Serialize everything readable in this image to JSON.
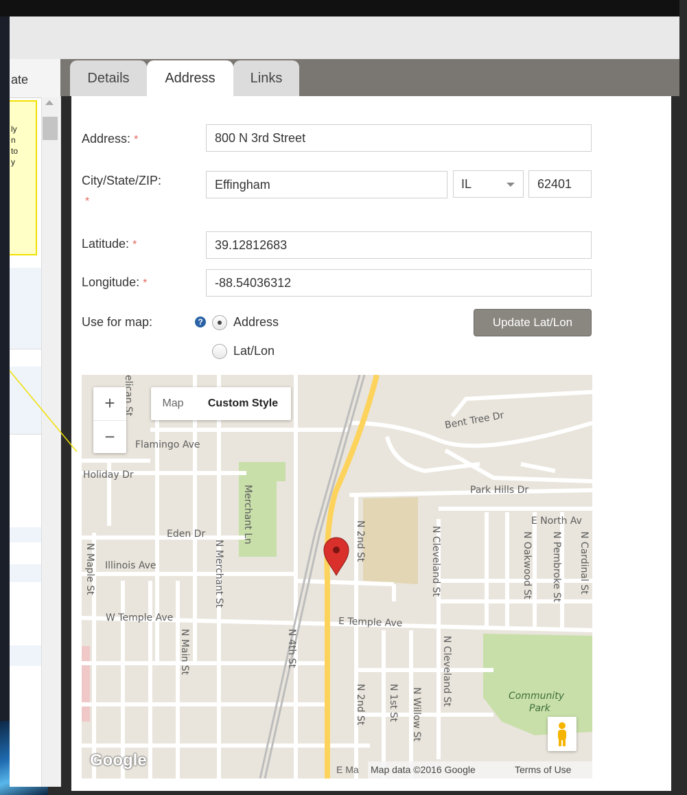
{
  "left_panel": {
    "header_text": "ate",
    "note_lines": [
      "ly",
      "n",
      " to",
      "y"
    ]
  },
  "tabs": [
    {
      "label": "Details"
    },
    {
      "label": "Address",
      "active": true
    },
    {
      "label": "Links"
    }
  ],
  "form": {
    "address_label": "Address:",
    "address_value": "800 N 3rd Street",
    "city_state_zip_label": "City/State/ZIP:",
    "city_value": "Effingham",
    "state_value": "IL",
    "zip_value": "62401",
    "latitude_label": "Latitude:",
    "latitude_value": "39.12812683",
    "longitude_label": "Longitude:",
    "longitude_value": "-88.54036312",
    "required_mark": "*",
    "use_for_map_label": "Use for map:",
    "help_icon": "?",
    "radio_address_label": "Address",
    "radio_latlon_label": "Lat/Lon",
    "selected_option": "Address",
    "update_button": "Update Lat/Lon"
  },
  "map": {
    "zoom_in": "+",
    "zoom_out": "−",
    "type_map": "Map",
    "type_custom": "Custom Style",
    "logo": "Google",
    "attribution": "Map data ©2016 Google",
    "terms": "Terms of Use",
    "partial_street": "E Ma",
    "streets": {
      "bent_tree": "Bent Tree Dr",
      "flamingo": "Flamingo Ave",
      "holiday": "Holiday Dr",
      "park_hills": "Park Hills Dr",
      "e_north": "E North Av",
      "eden": "Eden Dr",
      "illinois": "Illinois Ave",
      "w_temple": "W Temple Ave",
      "e_temple": "E Temple Ave",
      "maple": "N Maple St",
      "merchant": "N Merchant St",
      "merchant_ln": "Merchant Ln",
      "main": "N Main St",
      "fourth": "N 4th St",
      "second_top": "N 2nd St",
      "second_bottom": "N 2nd St",
      "first": "N 1st St",
      "willow": "N Willow St",
      "cleveland_top": "N Cleveland St",
      "cleveland_bottom": "N Cleveland St",
      "oakwood": "N Oakwood St",
      "pembroke": "N Pembroke St",
      "cardinal": "N Cardinal St",
      "pelican": "elican St",
      "community_park": "Community",
      "community_park2": "Park"
    }
  },
  "colors": {
    "tab_bar": "#7a7772",
    "required": "#e2675e",
    "button": "#8a8680",
    "map_land": "#e9e5dc",
    "park": "#c8dfa9",
    "highway": "#fdd35c",
    "marker": "#d9302c"
  }
}
